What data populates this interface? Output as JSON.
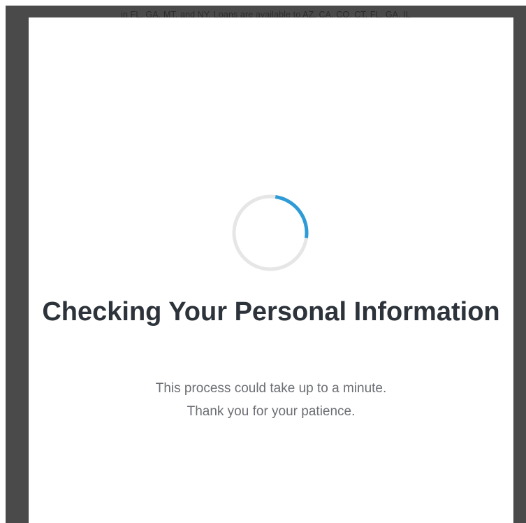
{
  "background": {
    "partial_text": "in FL, GA, MT, and NY. Loans are available to AZ, CA, CO, CT, FL, GA, IL"
  },
  "modal": {
    "spinner_icon": "loading-spinner-icon",
    "title": "Checking Your Personal Information",
    "subtitle_line1": "This process could take up to a minute.",
    "subtitle_line2": "Thank you for your patience."
  },
  "colors": {
    "overlay": "#4a4a4a",
    "modal_bg": "#ffffff",
    "spinner_track": "#e6e6e6",
    "spinner_accent": "#2f9bd6",
    "title": "#2c333a",
    "subtitle": "#6b6e73"
  }
}
